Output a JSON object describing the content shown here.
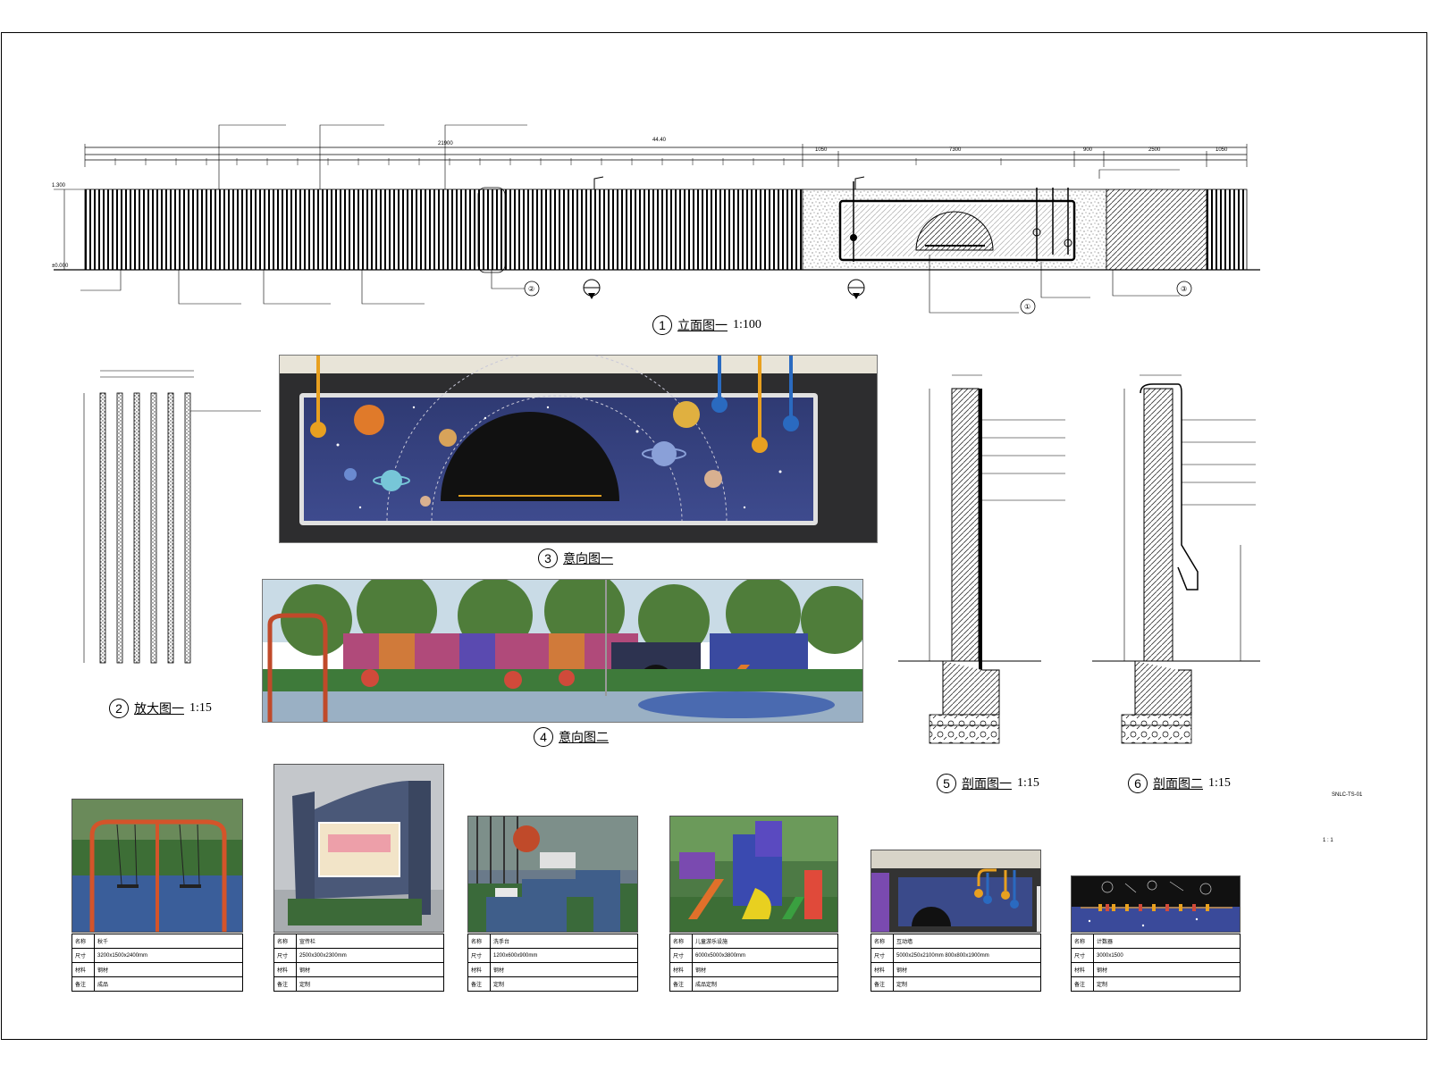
{
  "captions": {
    "c1": {
      "num": "1",
      "title": "立面图一",
      "scale": "1:100"
    },
    "c2": {
      "num": "2",
      "title": "放大图一",
      "scale": "1:15"
    },
    "c3": {
      "num": "3",
      "title": "意向图一",
      "scale": ""
    },
    "c4": {
      "num": "4",
      "title": "意向图二",
      "scale": ""
    },
    "c5": {
      "num": "5",
      "title": "剖面图一",
      "scale": "1:15"
    },
    "c6": {
      "num": "6",
      "title": "剖面图二",
      "scale": "1:15"
    }
  },
  "elevation": {
    "overall_dims": [
      "21900",
      "44.40",
      "1050",
      "7300",
      "900",
      "2500",
      "1050"
    ],
    "left_levels": [
      "±0.000",
      "1.300"
    ],
    "callout_symbols": [
      "①",
      "②",
      "③"
    ]
  },
  "side_notes": [
    "SNLC-TS-01",
    "1 : 1"
  ],
  "cards": [
    {
      "rows": [
        [
          "名称",
          "秋千"
        ],
        [
          "尺寸",
          "3200x1500x2400mm"
        ],
        [
          "材料",
          "钢材"
        ],
        [
          "备注",
          "成品"
        ]
      ]
    },
    {
      "rows": [
        [
          "名称",
          "宣传栏"
        ],
        [
          "尺寸",
          "2500x300x2300mm"
        ],
        [
          "材料",
          "钢材"
        ],
        [
          "备注",
          "定制"
        ]
      ]
    },
    {
      "rows": [
        [
          "名称",
          "洗手台"
        ],
        [
          "尺寸",
          "1200x600x900mm"
        ],
        [
          "材料",
          "钢材"
        ],
        [
          "备注",
          "定制"
        ]
      ]
    },
    {
      "rows": [
        [
          "名称",
          "儿童游乐设施"
        ],
        [
          "尺寸",
          "6000x5000x3800mm"
        ],
        [
          "材料",
          "钢材"
        ],
        [
          "备注",
          "成品定制"
        ]
      ]
    },
    {
      "rows": [
        [
          "名称",
          "互动墙"
        ],
        [
          "尺寸",
          "5000x250x2100mm  800x800x1900mm"
        ],
        [
          "材料",
          "钢材"
        ],
        [
          "备注",
          "定制"
        ]
      ]
    },
    {
      "rows": [
        [
          "名称",
          "计数器"
        ],
        [
          "尺寸",
          "3000x1500"
        ],
        [
          "材料",
          "钢材"
        ],
        [
          "备注",
          "定制"
        ]
      ]
    }
  ]
}
